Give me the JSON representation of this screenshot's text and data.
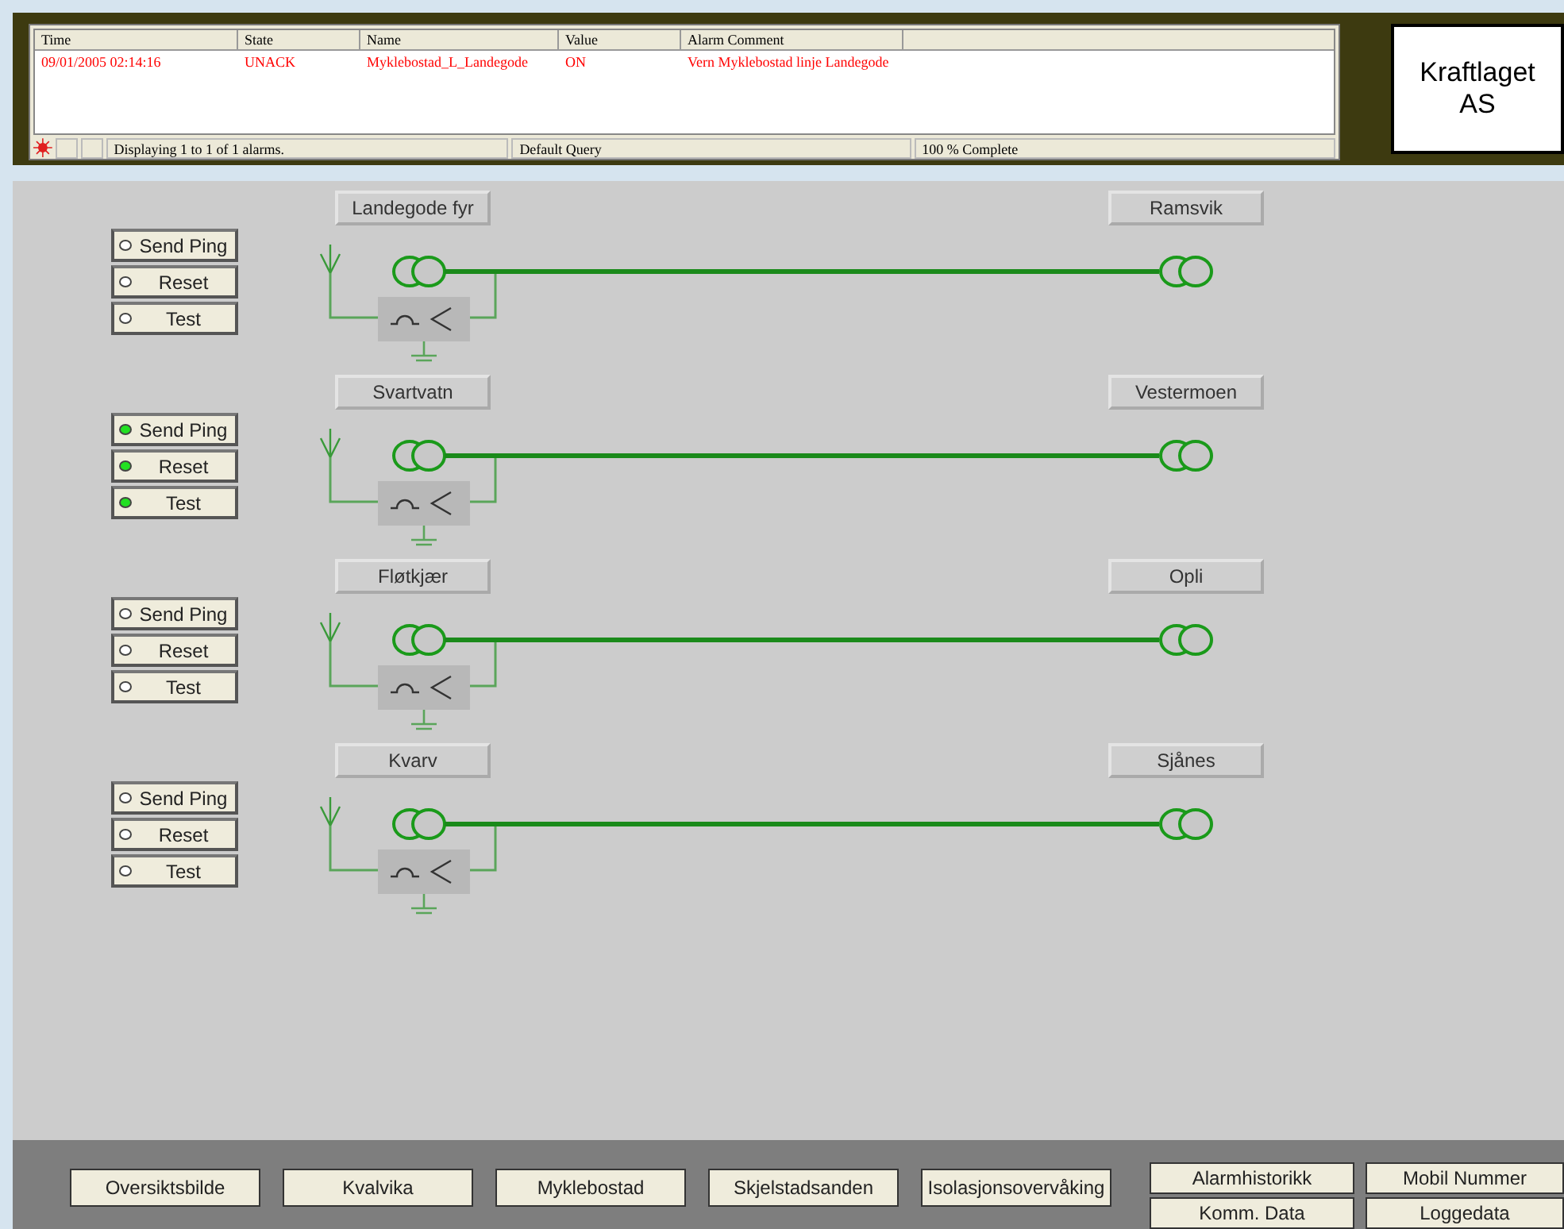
{
  "alarm_table": {
    "columns": [
      "Time",
      "State",
      "Name",
      "Value",
      "Alarm Comment"
    ],
    "rows": [
      {
        "cells": [
          "09/01/2005 02:14:16",
          "UNACK",
          "Myklebostad_L_Landegode",
          "ON",
          "Vern Myklebostad linje Landegode"
        ]
      }
    ],
    "status_bar": [
      "Displaying 1 to 1 of 1 alarms.",
      "Default Query",
      "100 % Complete"
    ]
  },
  "logo": {
    "line_1": "Kraftlaget",
    "line_2": "AS"
  },
  "lines": [
    {
      "left_station": "Landegode fyr",
      "right_station": "Ramsvik",
      "buttons": [
        {
          "label": "Send Ping",
          "on": false
        },
        {
          "label": "Reset",
          "on": false
        },
        {
          "label": "Test",
          "on": false
        }
      ]
    },
    {
      "left_station": "Svartvatn",
      "right_station": "Vestermoen",
      "buttons": [
        {
          "label": "Send Ping",
          "on": true
        },
        {
          "label": "Reset",
          "on": true
        },
        {
          "label": "Test",
          "on": true
        }
      ]
    },
    {
      "left_station": "Fløtkjær",
      "right_station": "Opli",
      "buttons": [
        {
          "label": "Send Ping",
          "on": false
        },
        {
          "label": "Reset",
          "on": false
        },
        {
          "label": "Test",
          "on": false
        }
      ]
    },
    {
      "left_station": "Kvarv",
      "right_station": "Sjånes",
      "buttons": [
        {
          "label": "Send Ping",
          "on": false
        },
        {
          "label": "Reset",
          "on": false
        },
        {
          "label": "Test",
          "on": false
        }
      ]
    }
  ],
  "nav_buttons": [
    "Oversiktsbilde",
    "Kvalvika",
    "Myklebostad",
    "Skjelstadsanden",
    "Isolasjonsovervåking"
  ],
  "side_buttons": [
    [
      "Alarmhistorikk",
      "Mobil Nummer"
    ],
    [
      "Komm. Data",
      "Loggedata"
    ]
  ]
}
